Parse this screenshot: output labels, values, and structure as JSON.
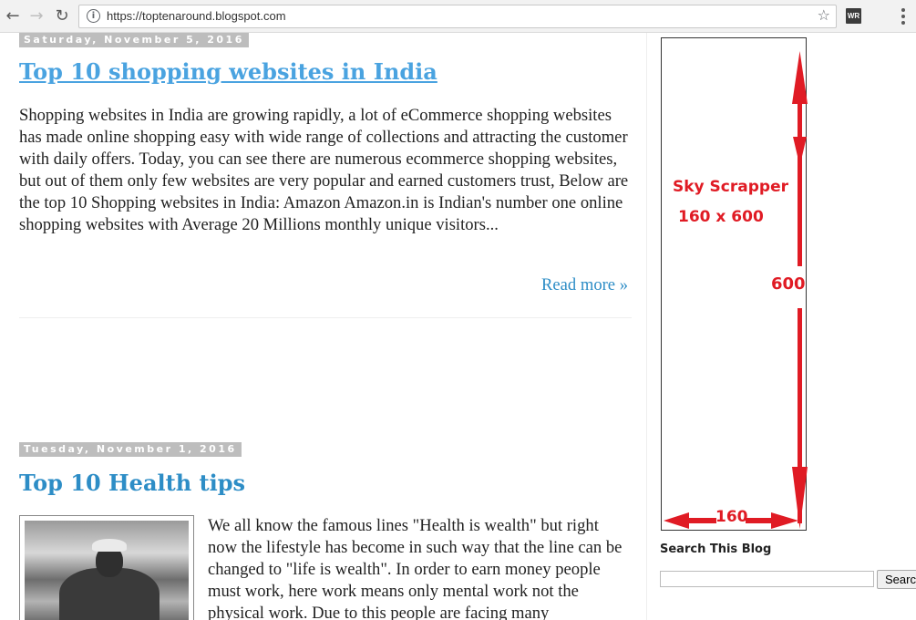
{
  "browser": {
    "url": "https://toptenaround.blogspot.com",
    "back_icon": "back-arrow",
    "forward_icon": "forward-arrow",
    "reload_icon": "reload",
    "info_icon": "info",
    "star_icon": "star",
    "extension_label": "WR",
    "menu_icon": "three-dot-menu"
  },
  "posts": [
    {
      "date": "Saturday, November 5, 2016",
      "title": "Top 10 shopping websites in India",
      "snippet": "Shopping websites in India are growing rapidly, a lot of eCommerce shopping websites has made online shopping easy with wide range of collections and attracting the customer with daily offers. Today, you can see there are numerous ecommerce shopping websites, but out of them only few websites are very popular and earned customers trust, Below are the top 10 Shopping websites in India: Amazon Amazon.in is Indian's number one online shopping websites with Average 20 Millions monthly unique visitors...",
      "read_more": "Read more »"
    },
    {
      "date": "Tuesday, November 1, 2016",
      "title": "Top 10 Health tips",
      "snippet": "We all know the famous lines \"Health is wealth\" but right now the lifestyle has become in such way that the line can be changed to \"life is wealth\". In order to earn money people must work, here work means only mental work not the physical work. Due to this people are facing many"
    }
  ],
  "sidebar": {
    "ad": {
      "name": "Sky Scrapper",
      "size": "160 x 600",
      "height_label": "600",
      "width_label": "160"
    },
    "search_title": "Search This Blog",
    "search_button": "Search"
  },
  "colors": {
    "link": "#2d8dc6",
    "ad_red": "#e01b24",
    "date_bg": "#bdbdbd"
  }
}
